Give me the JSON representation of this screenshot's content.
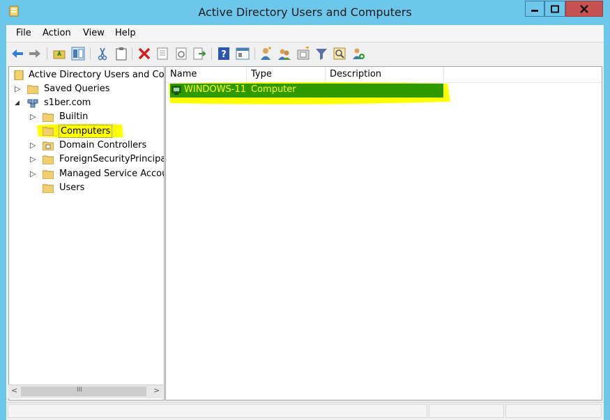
{
  "window": {
    "title": "Active Directory Users and Computers",
    "colors": {
      "frame": "#6cc7eb",
      "close_button": "#c75050",
      "highlight_yellow": "#ffff00",
      "selected_row": "#2e9a00"
    }
  },
  "menubar": {
    "items": [
      {
        "label": "File"
      },
      {
        "label": "Action"
      },
      {
        "label": "View"
      },
      {
        "label": "Help"
      }
    ]
  },
  "toolbar": {
    "icons": [
      "back-arrow-icon",
      "forward-arrow-icon",
      "up-folder-icon",
      "show-tree-icon",
      "cut-icon",
      "paste-icon",
      "delete-icon",
      "properties-icon",
      "refresh-icon",
      "export-list-icon",
      "help-icon",
      "show-console-icon",
      "new-user-icon",
      "new-group-icon",
      "new-ou-icon",
      "filter-icon",
      "find-icon",
      "add-to-group-icon"
    ]
  },
  "tree": {
    "root_label": "Active Directory Users and Com",
    "items": [
      {
        "label": "Saved Queries",
        "expander": "▷"
      },
      {
        "label": "s1ber.com",
        "expander": "◢"
      },
      {
        "label": "Builtin",
        "expander": "▷"
      },
      {
        "label": "Computers",
        "expander": ""
      },
      {
        "label": "Domain Controllers",
        "expander": "▷"
      },
      {
        "label": "ForeignSecurityPrincipals",
        "expander": "▷"
      },
      {
        "label": "Managed Service Accour",
        "expander": "▷"
      },
      {
        "label": "Users",
        "expander": ""
      }
    ],
    "selected": "Computers"
  },
  "list": {
    "columns": [
      "Name",
      "Type",
      "Description"
    ],
    "rows": [
      {
        "name": "WINDOWS-11",
        "type": "Computer",
        "description": ""
      }
    ]
  },
  "scrollbar": {
    "left": "<",
    "right": ">",
    "grip": "III"
  }
}
